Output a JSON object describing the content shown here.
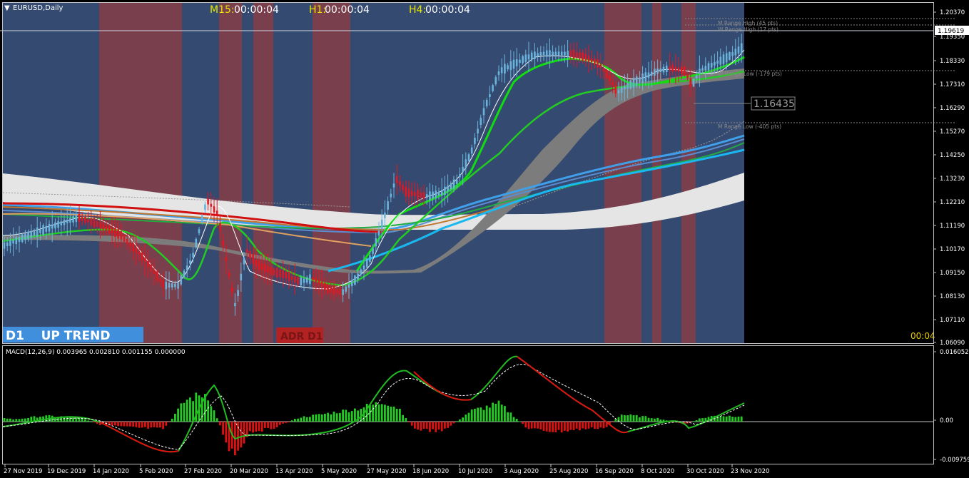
{
  "chart_title": "EURUSD,Daily",
  "timers": {
    "m15_label": "M15:",
    "m15_value": "00:00:04",
    "h1_label": "H1:",
    "h1_value": "00:00:04",
    "h4_label": "H4:",
    "h4_value": "00:00:04"
  },
  "trend_label": "D1    UP TREND",
  "adr_label": "ADR D1",
  "countdown": "00:04",
  "current_price": "1.19619",
  "pivot_price": "1.16435",
  "range_labels": {
    "m_high": "M Range High (45 pts)",
    "w_high": "W Range High (17 pts)",
    "w_low": "W Range Low (-179 pts)",
    "m_low": "M Range Low (-405 pts)"
  },
  "price_axis": [
    "1.20370",
    "1.19350",
    "1.18330",
    "1.17310",
    "1.16290",
    "1.15270",
    "1.14250",
    "1.13230",
    "1.12210",
    "1.11190",
    "1.10170",
    "1.09150",
    "1.08130",
    "1.07110",
    "1.06090"
  ],
  "macd_label": "MACD(12,26,9) 0.003965 0.002810 0.001155 0.000000",
  "macd_axis": [
    "0.016052",
    "0.00",
    "-0.009759"
  ],
  "date_axis": [
    "27 Nov 2019",
    "19 Dec 2019",
    "14 Jan 2020",
    "5 Feb 2020",
    "27 Feb 2020",
    "20 Mar 2020",
    "13 Apr 2020",
    "5 May 2020",
    "27 May 2020",
    "18 Jun 2020",
    "10 Jul 2020",
    "3 Aug 2020",
    "25 Aug 2020",
    "16 Sep 2020",
    "8 Oct 2020",
    "30 Oct 2020",
    "23 Nov 2020"
  ],
  "colors": {
    "bull_zone": "#344a70",
    "bear_zone": "#7a3f4c",
    "trend_box": "#3f8fdc",
    "adr_box": "#b22222",
    "macd_up": "#22cc22",
    "macd_down": "#dd1111",
    "candle_bull": "#6ab4dc",
    "candle_bear": "#e8141e",
    "timer_label": "#e8e800",
    "timer_value": "#ffffff"
  },
  "chart_data": {
    "type": "candlestick",
    "symbol": "EURUSD",
    "timeframe": "Daily",
    "ylim": [
      1.0609,
      1.2037
    ],
    "x": [
      "27 Nov 2019",
      "19 Dec 2019",
      "14 Jan 2020",
      "5 Feb 2020",
      "27 Feb 2020",
      "20 Mar 2020",
      "13 Apr 2020",
      "5 May 2020",
      "27 May 2020",
      "18 Jun 2020",
      "10 Jul 2020",
      "3 Aug 2020",
      "25 Aug 2020",
      "16 Sep 2020",
      "8 Oct 2020",
      "30 Oct 2020",
      "23 Nov 2020"
    ],
    "close_approx": [
      1.101,
      1.112,
      1.113,
      1.099,
      1.086,
      1.09,
      1.088,
      1.083,
      1.099,
      1.124,
      1.13,
      1.178,
      1.185,
      1.172,
      1.175,
      1.165,
      1.1961
    ],
    "macd_values": [
      0.0005,
      0.001,
      0.0008,
      -0.006,
      0.01,
      -0.009,
      -0.004,
      -0.001,
      0.004,
      0.015,
      0.006,
      0.016,
      0.013,
      -0.004,
      0.0,
      -0.003,
      0.004
    ]
  }
}
